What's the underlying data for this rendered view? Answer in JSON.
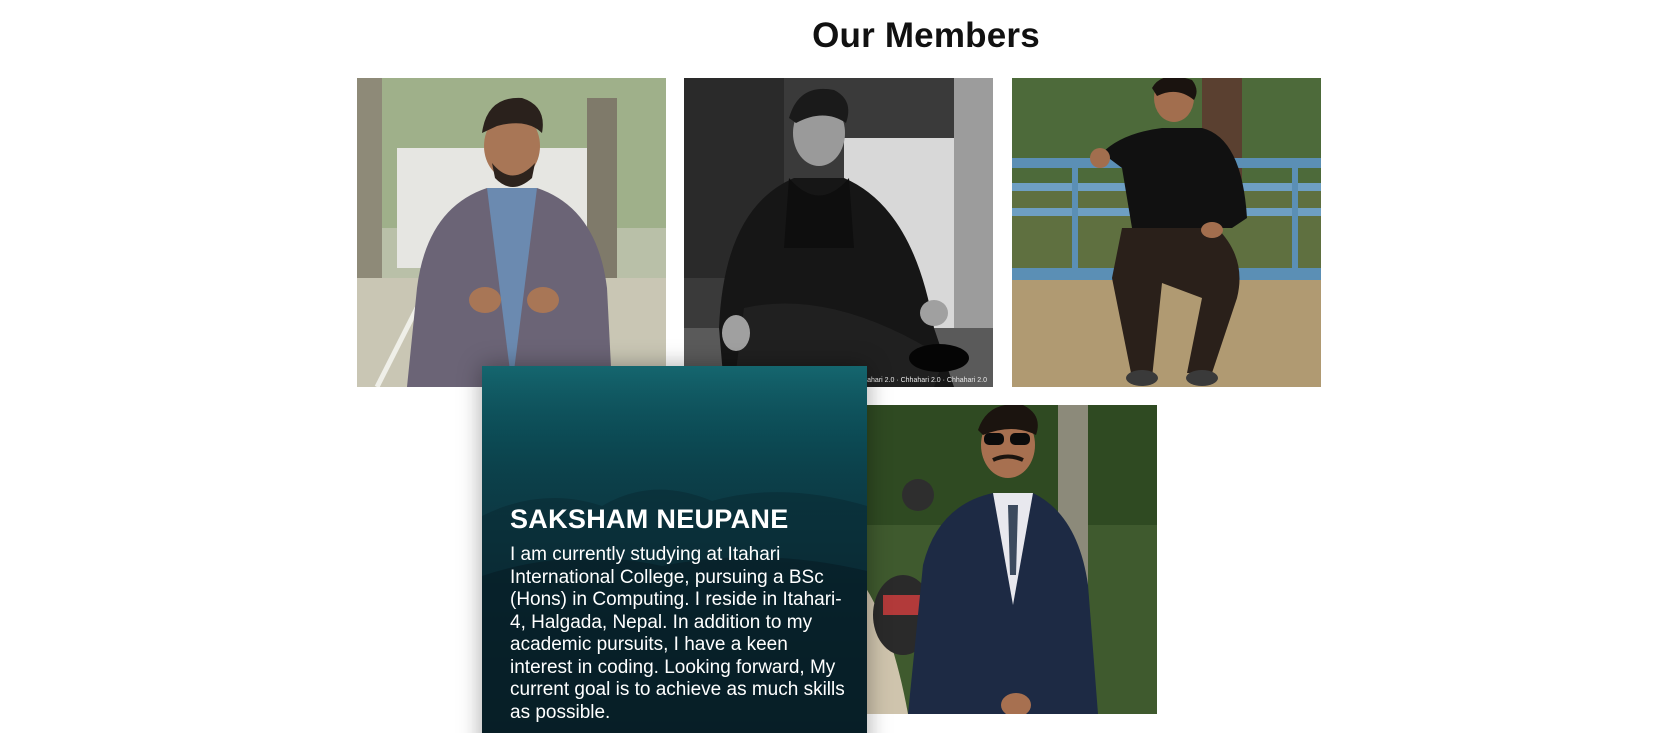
{
  "page": {
    "heading": "Our Members"
  },
  "members": [
    {
      "photo_icon": "member-photo-1"
    },
    {
      "photo_icon": "member-photo-2",
      "watermark": "Chhahari 2.0 · Chhahari 2.0 · Chhahari 2.0"
    },
    {
      "photo_icon": "member-photo-3"
    },
    {
      "photo_icon": "member-photo-4"
    }
  ],
  "featured": {
    "name": "SAKSHAM NEUPANE",
    "bio": "I am currently studying at Itahari International College, pursuing a BSc (Hons) in Computing. I reside in Itahari-4, Halgada, Nepal. In addition to my academic pursuits, I have a keen interest in coding. Looking forward, My current goal is to achieve as much skills as possible."
  },
  "colors": {
    "card_top": "#0c5a63",
    "card_bottom": "#06161d",
    "heading": "#111111"
  }
}
